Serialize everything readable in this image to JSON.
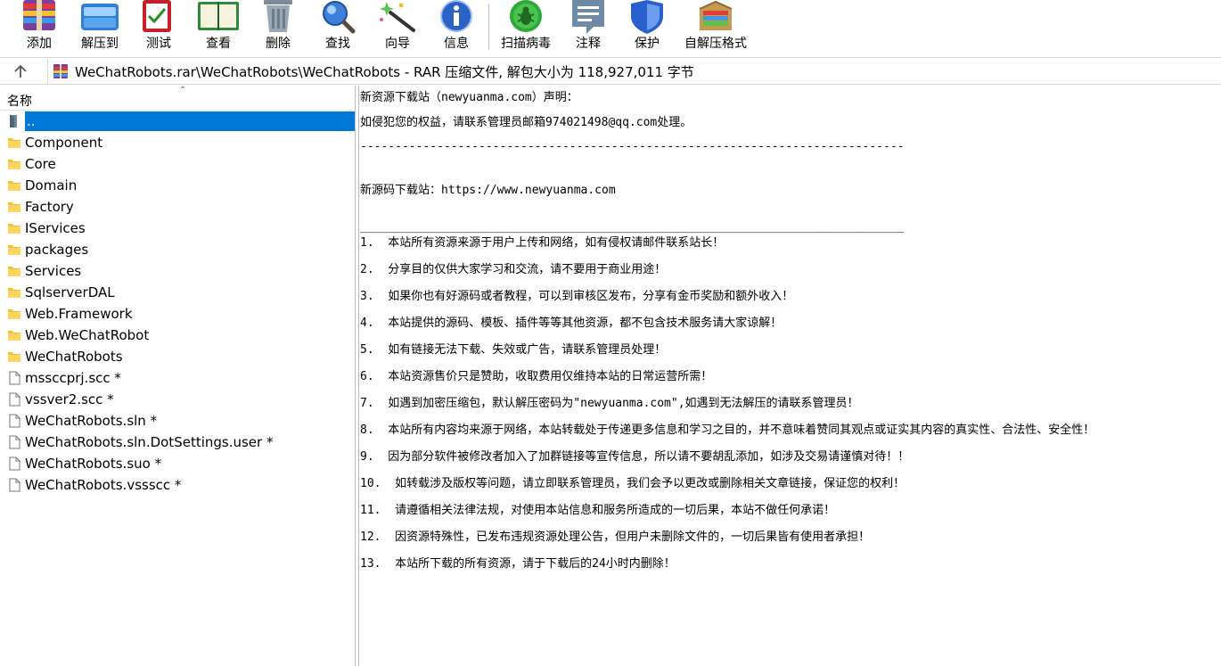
{
  "toolbar": {
    "buttons": [
      {
        "label": "添加",
        "icon": "add-archive-icon"
      },
      {
        "label": "解压到",
        "icon": "extract-to-icon"
      },
      {
        "label": "测试",
        "icon": "test-icon"
      },
      {
        "label": "查看",
        "icon": "view-icon"
      },
      {
        "label": "删除",
        "icon": "delete-icon"
      },
      {
        "label": "查找",
        "icon": "find-icon"
      },
      {
        "label": "向导",
        "icon": "wizard-icon"
      },
      {
        "label": "信息",
        "icon": "info-icon"
      },
      {
        "label": "扫描病毒",
        "icon": "virus-scan-icon"
      },
      {
        "label": "注释",
        "icon": "comment-icon"
      },
      {
        "label": "保护",
        "icon": "protect-icon"
      },
      {
        "label": "自解压格式",
        "icon": "sfx-icon"
      }
    ]
  },
  "address": {
    "path": "WeChatRobots.rar\\WeChatRobots\\WeChatRobots - RAR 压缩文件, 解包大小为 118,927,011 字节"
  },
  "filelist": {
    "column_name": "名称",
    "items": [
      {
        "name": "..",
        "type": "parent",
        "selected": true
      },
      {
        "name": "Component",
        "type": "folder"
      },
      {
        "name": "Core",
        "type": "folder"
      },
      {
        "name": "Domain",
        "type": "folder"
      },
      {
        "name": "Factory",
        "type": "folder"
      },
      {
        "name": "IServices",
        "type": "folder"
      },
      {
        "name": "packages",
        "type": "folder"
      },
      {
        "name": "Services",
        "type": "folder"
      },
      {
        "name": "SqlserverDAL",
        "type": "folder"
      },
      {
        "name": "Web.Framework",
        "type": "folder"
      },
      {
        "name": "Web.WeChatRobot",
        "type": "folder"
      },
      {
        "name": "WeChatRobots",
        "type": "folder"
      },
      {
        "name": "mssccprj.scc *",
        "type": "file"
      },
      {
        "name": "vssver2.scc *",
        "type": "file"
      },
      {
        "name": "WeChatRobots.sln *",
        "type": "file"
      },
      {
        "name": "WeChatRobots.sln.DotSettings.user *",
        "type": "file"
      },
      {
        "name": "WeChatRobots.suo *",
        "type": "file"
      },
      {
        "name": "WeChatRobots.vssscc *",
        "type": "file"
      }
    ]
  },
  "comment": {
    "lines": [
      "新资源下载站（newyuanma.com）声明：",
      "如侵犯您的权益，请联系管理员邮箱974021498@qq.com处理。",
      "------------------------------------------------------------------------------",
      "新源码下载站：https://www.newyuanma.com",
      "______________________________________________________________________________",
      "1.  本站所有资源来源于用户上传和网络，如有侵权请邮件联系站长！",
      "2.  分享目的仅供大家学习和交流，请不要用于商业用途！",
      "3.  如果你也有好源码或者教程，可以到审核区发布，分享有金币奖励和额外收入！",
      "4.  本站提供的源码、模板、插件等等其他资源，都不包含技术服务请大家谅解！",
      "5.  如有链接无法下载、失效或广告，请联系管理员处理！",
      "6.  本站资源售价只是赞助，收取费用仅维持本站的日常运营所需！",
      "7.  如遇到加密压缩包，默认解压密码为\"newyuanma.com\",如遇到无法解压的请联系管理员！",
      "8.  本站所有内容均来源于网络，本站转载处于传递更多信息和学习之目的，并不意味着赞同其观点或证实其内容的真实性、合法性、安全性！",
      "9.  因为部分软件被修改者加入了加群链接等宣传信息，所以请不要胡乱添加，如涉及交易请谨慎对待！！",
      "10.  如转载涉及版权等问题，请立即联系管理员，我们会予以更改或删除相关文章链接，保证您的权利！",
      "11.  请遵循相关法律法规，对使用本站信息和服务所造成的一切后果，本站不做任何承诺！",
      "12.  因资源特殊性，已发布违规资源处理公告，但用户未删除文件的，一切后果皆有使用者承担！",
      "13.  本站所下载的所有资源，请于下载后的24小时内删除！"
    ]
  }
}
